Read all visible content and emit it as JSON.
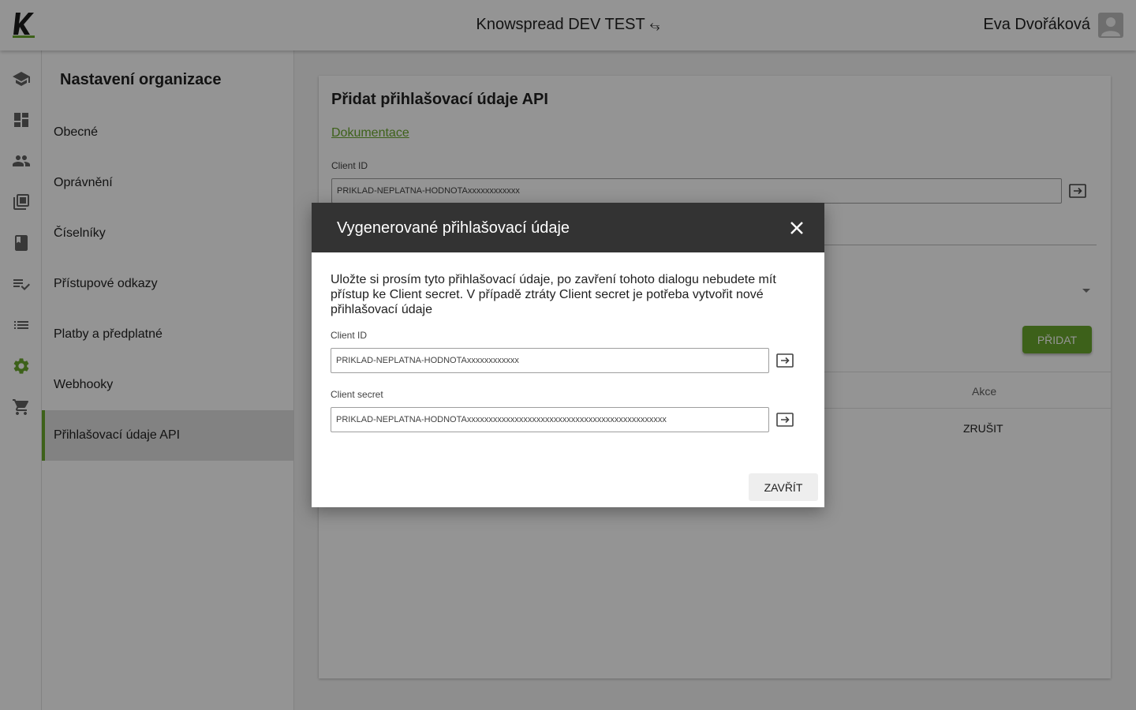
{
  "header": {
    "title": "Knowspread DEV TEST",
    "switch_glyph": "⥃",
    "user_name": "Eva Dvořáková"
  },
  "rail": {
    "icons": [
      "graduation-cap-icon",
      "dashboard-icon",
      "people-icon",
      "library-icon",
      "book-icon",
      "playlist-check-icon",
      "list-icon",
      "gear-icon",
      "cart-icon"
    ],
    "active": "gear-icon"
  },
  "menu": {
    "title": "Nastavení organizace",
    "items": [
      {
        "label": "Obecné"
      },
      {
        "label": "Oprávnění"
      },
      {
        "label": "Číselníky"
      },
      {
        "label": "Přístupové odkazy"
      },
      {
        "label": "Platby a předplatné"
      },
      {
        "label": "Webhooky"
      },
      {
        "label": "Přihlašovací údaje API"
      }
    ],
    "active_index": 6
  },
  "card": {
    "title": "Přidat přihlašovací údaje API",
    "doc_link": "Dokumentace",
    "client_id_label": "Client ID",
    "client_id_value": "PRIKLAD-NEPLATNA-HODNOTAxxxxxxxxxxxx",
    "add_button": "PŘIDAT",
    "table_header_actions": "Akce",
    "row_cancel": "ZRUŠIT"
  },
  "dialog": {
    "title": "Vygenerované přihlašovací údaje",
    "message": "Uložte si prosím tyto přihlašovací údaje, po zavření tohoto dialogu nebudete mít přístup ke Client secret. V případě ztráty Client secret je potřeba vytvořit nové přihlašovací údaje",
    "client_id_label": "Client ID",
    "client_id_value": "PRIKLAD-NEPLATNA-HODNOTAxxxxxxxxxxxx",
    "client_secret_label": "Client secret",
    "client_secret_value": "PRIKLAD-NEPLATNA-HODNOTAxxxxxxxxxxxxxxxxxxxxxxxxxxxxxxxxxxxxxxxxxxxxxx",
    "close_button": "ZAVŘÍT"
  },
  "colors": {
    "accent": "#6aa82d",
    "dialog_header": "#333333"
  }
}
